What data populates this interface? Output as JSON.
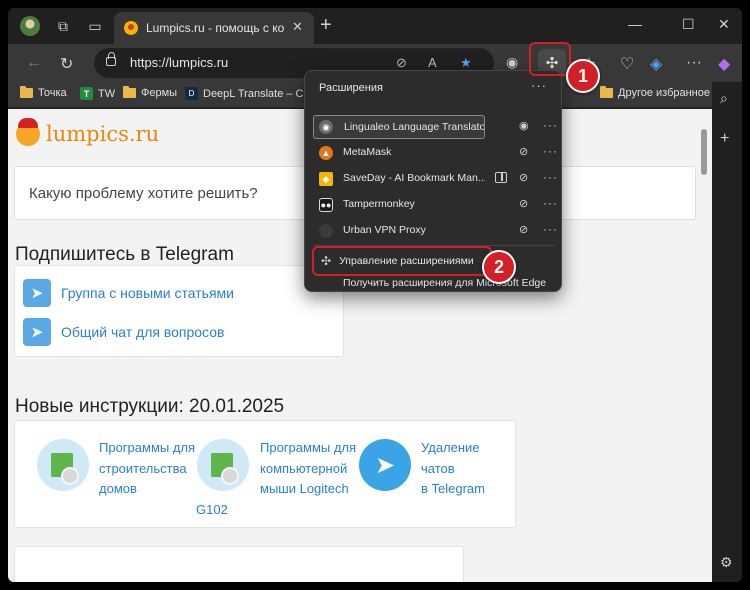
{
  "browser": {
    "tab_title": "Lumpics.ru - помощь с компьют",
    "url": "https://lumpics.ru",
    "step1_label": "1",
    "step2_label": "2"
  },
  "bookmarks": {
    "items": [
      {
        "label": "Точка",
        "icon": "folder-icon"
      },
      {
        "label": "TW",
        "icon": "tw-icon"
      },
      {
        "label": "Фермы",
        "icon": "folder-icon"
      },
      {
        "label": "DeepL Translate – С...",
        "icon": "deepl-icon"
      }
    ],
    "other": "Другое избранное"
  },
  "extensions_popup": {
    "title": "Расширения",
    "items": [
      {
        "name": "Lingualeo Language Translator",
        "icon_color": "#6b6b6b"
      },
      {
        "name": "MetaMask",
        "icon_color": "#e2761b"
      },
      {
        "name": "SaveDay - AI Bookmark Man...",
        "icon_color": "#f2b705"
      },
      {
        "name": "Tampermonkey",
        "icon_color": "#1b1b1b"
      },
      {
        "name": "Urban VPN Proxy",
        "icon_color": "#3b3b3b"
      }
    ],
    "manage_label": "Управление расширениями",
    "get_more_label": "Получить расширения для Microsoft Edge"
  },
  "page": {
    "logo_text": "lumpics.ru",
    "search_placeholder": "Какую проблему хотите решить?",
    "telegram_heading": "Подпишитесь в Telegram",
    "telegram_links": [
      "Группа с новыми статьями",
      "Общий чат для вопросов"
    ],
    "new_heading": "Новые инструкции: 20.01.2025",
    "articles": [
      {
        "line1": "Программы для",
        "line2": "строительства",
        "line3": "домов"
      },
      {
        "line1": "Программы для",
        "line2": "компьютерной",
        "line3": "мыши Logitech",
        "line4": "G102"
      },
      {
        "line1": "Удаление чатов",
        "line2": "в Telegram"
      }
    ]
  },
  "colors": {
    "accent_red": "#d51f26",
    "link_blue": "#2a7fd0",
    "logo_orange": "#e8860c"
  }
}
